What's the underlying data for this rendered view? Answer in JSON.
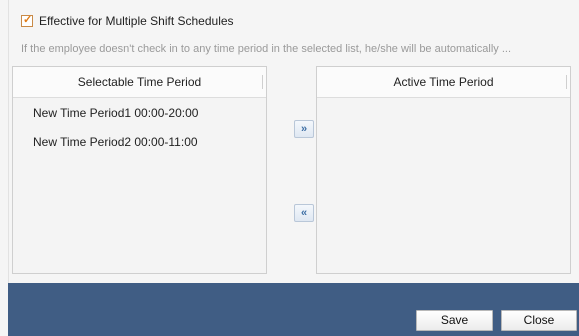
{
  "checkbox": {
    "label": "Effective for Multiple Shift Schedules",
    "checked": true,
    "check_glyph": "✓"
  },
  "hint": {
    "text": "If the employee doesn't check in to any time period in the selected list, he/she will be automatically ..."
  },
  "selectable": {
    "header": "Selectable Time Period",
    "items": [
      {
        "label": "New Time Period1 00:00-20:00"
      },
      {
        "label": "New Time Period2 00:00-11:00"
      }
    ]
  },
  "active": {
    "header": "Active Time Period",
    "items": []
  },
  "transfer": {
    "add_icon": "double-chevron-right-icon",
    "add_glyph": "»",
    "remove_icon": "double-chevron-left-icon",
    "remove_glyph": "«"
  },
  "footer": {
    "save_label": "Save",
    "close_label": "Close"
  },
  "colors": {
    "footer_bg": "#405d84",
    "checkbox_accent": "#e07b16",
    "hint_text": "#9a9a9a"
  }
}
